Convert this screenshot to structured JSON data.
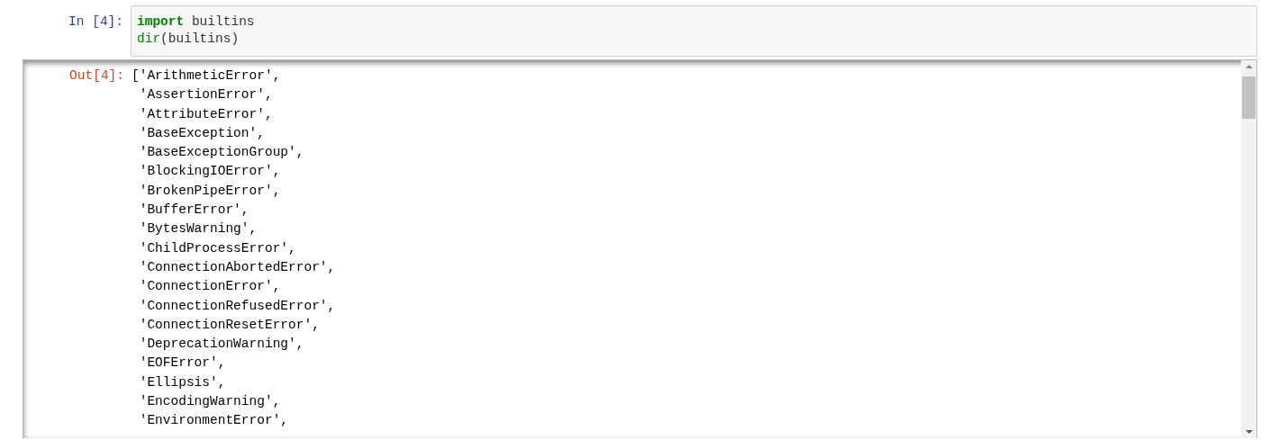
{
  "input_cell": {
    "prompt": "In [4]:",
    "lines": [
      [
        {
          "kind": "keyword",
          "text": "import"
        },
        {
          "kind": "plain",
          "text": " builtins"
        }
      ],
      [
        {
          "kind": "builtin",
          "text": "dir"
        },
        {
          "kind": "plain",
          "text": "(builtins)"
        }
      ]
    ]
  },
  "output_cell": {
    "prompt": "Out[4]:",
    "lines": [
      "['ArithmeticError',",
      " 'AssertionError',",
      " 'AttributeError',",
      " 'BaseException',",
      " 'BaseExceptionGroup',",
      " 'BlockingIOError',",
      " 'BrokenPipeError',",
      " 'BufferError',",
      " 'BytesWarning',",
      " 'ChildProcessError',",
      " 'ConnectionAbortedError',",
      " 'ConnectionError',",
      " 'ConnectionRefusedError',",
      " 'ConnectionResetError',",
      " 'DeprecationWarning',",
      " 'EOFError',",
      " 'Ellipsis',",
      " 'EncodingWarning',",
      " 'EnvironmentError',"
    ]
  }
}
